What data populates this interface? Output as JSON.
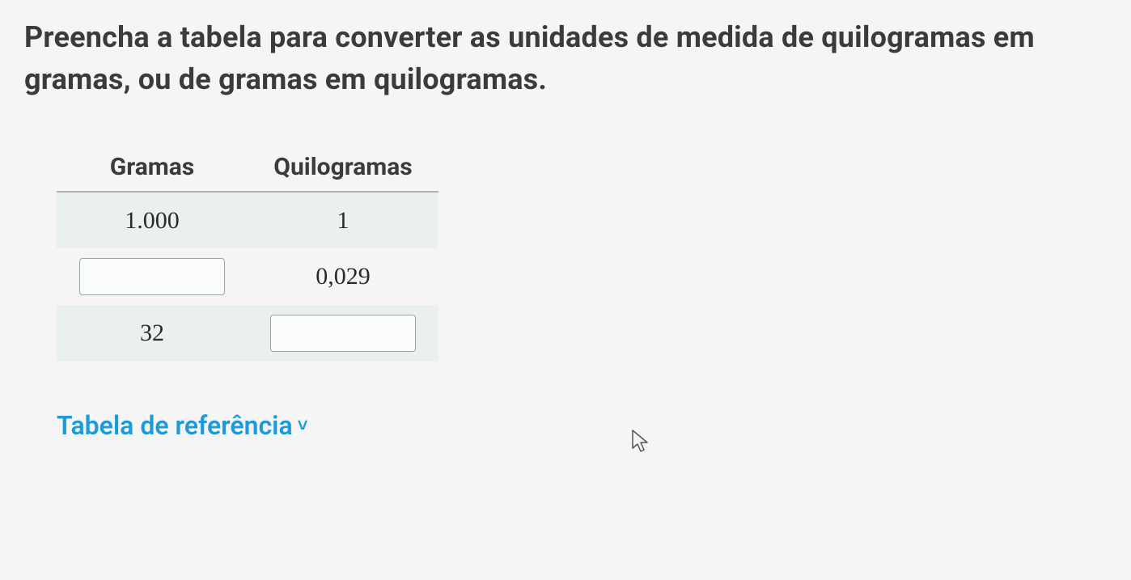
{
  "instruction": "Preencha a tabela para converter as unidades de medida de quilogramas em gramas, ou de gramas em quilogramas.",
  "table": {
    "headers": {
      "col1": "Gramas",
      "col2": "Quilogramas"
    },
    "rows": [
      {
        "gramas": "1.000",
        "quilogramas": "1"
      },
      {
        "gramas": "",
        "quilogramas": "0,029"
      },
      {
        "gramas": "32",
        "quilogramas": ""
      }
    ]
  },
  "reference": {
    "label": "Tabela de referência",
    "chevron": "˅"
  }
}
